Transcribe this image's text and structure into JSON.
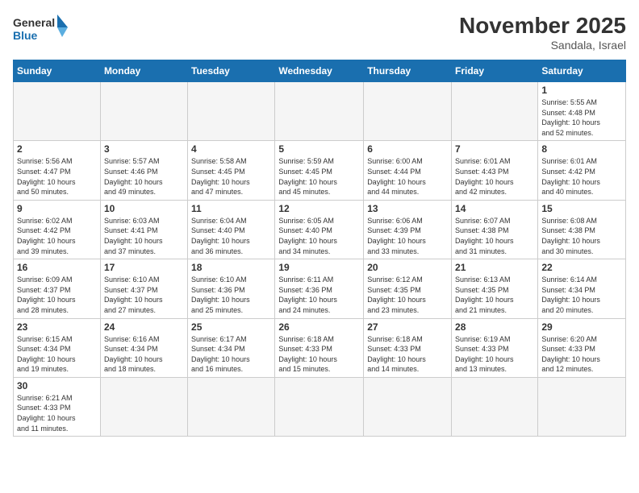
{
  "header": {
    "logo_general": "General",
    "logo_blue": "Blue",
    "month_title": "November 2025",
    "location": "Sandala, Israel"
  },
  "days_of_week": [
    "Sunday",
    "Monday",
    "Tuesday",
    "Wednesday",
    "Thursday",
    "Friday",
    "Saturday"
  ],
  "weeks": [
    [
      {
        "day": "",
        "info": ""
      },
      {
        "day": "",
        "info": ""
      },
      {
        "day": "",
        "info": ""
      },
      {
        "day": "",
        "info": ""
      },
      {
        "day": "",
        "info": ""
      },
      {
        "day": "",
        "info": ""
      },
      {
        "day": "1",
        "info": "Sunrise: 5:55 AM\nSunset: 4:48 PM\nDaylight: 10 hours\nand 52 minutes."
      }
    ],
    [
      {
        "day": "2",
        "info": "Sunrise: 5:56 AM\nSunset: 4:47 PM\nDaylight: 10 hours\nand 50 minutes."
      },
      {
        "day": "3",
        "info": "Sunrise: 5:57 AM\nSunset: 4:46 PM\nDaylight: 10 hours\nand 49 minutes."
      },
      {
        "day": "4",
        "info": "Sunrise: 5:58 AM\nSunset: 4:45 PM\nDaylight: 10 hours\nand 47 minutes."
      },
      {
        "day": "5",
        "info": "Sunrise: 5:59 AM\nSunset: 4:45 PM\nDaylight: 10 hours\nand 45 minutes."
      },
      {
        "day": "6",
        "info": "Sunrise: 6:00 AM\nSunset: 4:44 PM\nDaylight: 10 hours\nand 44 minutes."
      },
      {
        "day": "7",
        "info": "Sunrise: 6:01 AM\nSunset: 4:43 PM\nDaylight: 10 hours\nand 42 minutes."
      },
      {
        "day": "8",
        "info": "Sunrise: 6:01 AM\nSunset: 4:42 PM\nDaylight: 10 hours\nand 40 minutes."
      }
    ],
    [
      {
        "day": "9",
        "info": "Sunrise: 6:02 AM\nSunset: 4:42 PM\nDaylight: 10 hours\nand 39 minutes."
      },
      {
        "day": "10",
        "info": "Sunrise: 6:03 AM\nSunset: 4:41 PM\nDaylight: 10 hours\nand 37 minutes."
      },
      {
        "day": "11",
        "info": "Sunrise: 6:04 AM\nSunset: 4:40 PM\nDaylight: 10 hours\nand 36 minutes."
      },
      {
        "day": "12",
        "info": "Sunrise: 6:05 AM\nSunset: 4:40 PM\nDaylight: 10 hours\nand 34 minutes."
      },
      {
        "day": "13",
        "info": "Sunrise: 6:06 AM\nSunset: 4:39 PM\nDaylight: 10 hours\nand 33 minutes."
      },
      {
        "day": "14",
        "info": "Sunrise: 6:07 AM\nSunset: 4:38 PM\nDaylight: 10 hours\nand 31 minutes."
      },
      {
        "day": "15",
        "info": "Sunrise: 6:08 AM\nSunset: 4:38 PM\nDaylight: 10 hours\nand 30 minutes."
      }
    ],
    [
      {
        "day": "16",
        "info": "Sunrise: 6:09 AM\nSunset: 4:37 PM\nDaylight: 10 hours\nand 28 minutes."
      },
      {
        "day": "17",
        "info": "Sunrise: 6:10 AM\nSunset: 4:37 PM\nDaylight: 10 hours\nand 27 minutes."
      },
      {
        "day": "18",
        "info": "Sunrise: 6:10 AM\nSunset: 4:36 PM\nDaylight: 10 hours\nand 25 minutes."
      },
      {
        "day": "19",
        "info": "Sunrise: 6:11 AM\nSunset: 4:36 PM\nDaylight: 10 hours\nand 24 minutes."
      },
      {
        "day": "20",
        "info": "Sunrise: 6:12 AM\nSunset: 4:35 PM\nDaylight: 10 hours\nand 23 minutes."
      },
      {
        "day": "21",
        "info": "Sunrise: 6:13 AM\nSunset: 4:35 PM\nDaylight: 10 hours\nand 21 minutes."
      },
      {
        "day": "22",
        "info": "Sunrise: 6:14 AM\nSunset: 4:34 PM\nDaylight: 10 hours\nand 20 minutes."
      }
    ],
    [
      {
        "day": "23",
        "info": "Sunrise: 6:15 AM\nSunset: 4:34 PM\nDaylight: 10 hours\nand 19 minutes."
      },
      {
        "day": "24",
        "info": "Sunrise: 6:16 AM\nSunset: 4:34 PM\nDaylight: 10 hours\nand 18 minutes."
      },
      {
        "day": "25",
        "info": "Sunrise: 6:17 AM\nSunset: 4:34 PM\nDaylight: 10 hours\nand 16 minutes."
      },
      {
        "day": "26",
        "info": "Sunrise: 6:18 AM\nSunset: 4:33 PM\nDaylight: 10 hours\nand 15 minutes."
      },
      {
        "day": "27",
        "info": "Sunrise: 6:18 AM\nSunset: 4:33 PM\nDaylight: 10 hours\nand 14 minutes."
      },
      {
        "day": "28",
        "info": "Sunrise: 6:19 AM\nSunset: 4:33 PM\nDaylight: 10 hours\nand 13 minutes."
      },
      {
        "day": "29",
        "info": "Sunrise: 6:20 AM\nSunset: 4:33 PM\nDaylight: 10 hours\nand 12 minutes."
      }
    ],
    [
      {
        "day": "30",
        "info": "Sunrise: 6:21 AM\nSunset: 4:33 PM\nDaylight: 10 hours\nand 11 minutes."
      },
      {
        "day": "",
        "info": ""
      },
      {
        "day": "",
        "info": ""
      },
      {
        "day": "",
        "info": ""
      },
      {
        "day": "",
        "info": ""
      },
      {
        "day": "",
        "info": ""
      },
      {
        "day": "",
        "info": ""
      }
    ]
  ]
}
